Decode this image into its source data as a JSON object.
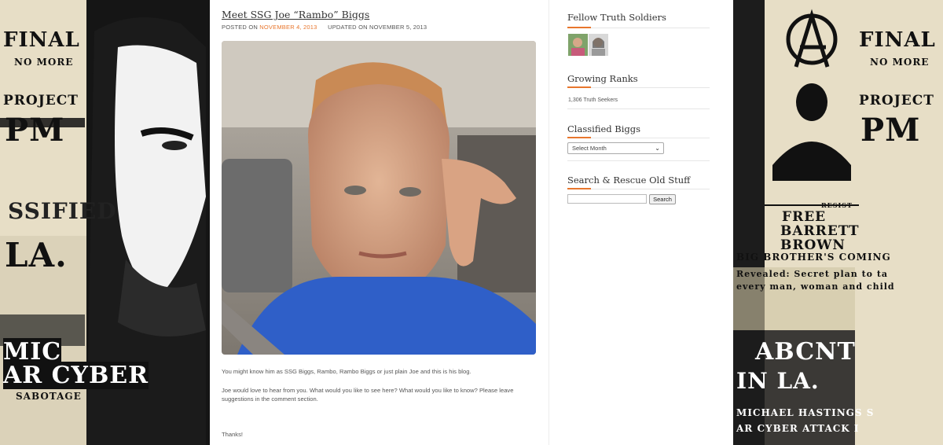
{
  "post": {
    "title": "Meet SSG Joe “Rambo” Biggs",
    "posted_label": "POSTED ON",
    "posted_date": "NOVEMBER 4, 2013",
    "updated_label": "UPDATED ON",
    "updated_date": "NOVEMBER 5, 2013",
    "paragraphs": [
      "You might know him as SSG Biggs, Rambo, Rambo Biggs or just plain Joe and this is his blog.",
      "Joe would love to hear from you. What would you like to see here? What would you like to know? Please leave suggestions in the comment section.",
      "Thanks!"
    ]
  },
  "sidebar": {
    "fellow": {
      "title": "Fellow Truth Soldiers"
    },
    "ranks": {
      "title": "Growing Ranks",
      "count_text": "1,306 Truth Seekers"
    },
    "archive": {
      "title": "Classified Biggs",
      "select_value": "Select Month"
    },
    "search": {
      "title": "Search & Rescue Old Stuff",
      "button_label": "Search",
      "input_value": ""
    }
  },
  "background": {
    "left_words": [
      "FINAL",
      "NO MORE",
      "PROJECT",
      "PM",
      "SSIFIED",
      "LA.",
      "MIC",
      "AR CYBER",
      "SABOTAGE"
    ],
    "right_words": [
      "FINAL",
      "NO MORE",
      "PROJECT",
      "PM",
      "RESIST",
      "FREE",
      "BARRETT",
      "BROWN",
      "BIG BROTHER'S COMING",
      "Revealed: Secret plan to ta",
      "every man, woman and child",
      "ABCNT",
      "IN LA.",
      "MICHAEL HASTINGS S",
      "AR CYBER ATTACK I"
    ]
  },
  "colors": {
    "accent": "#e8762d",
    "paper": "#e9e2cf"
  }
}
